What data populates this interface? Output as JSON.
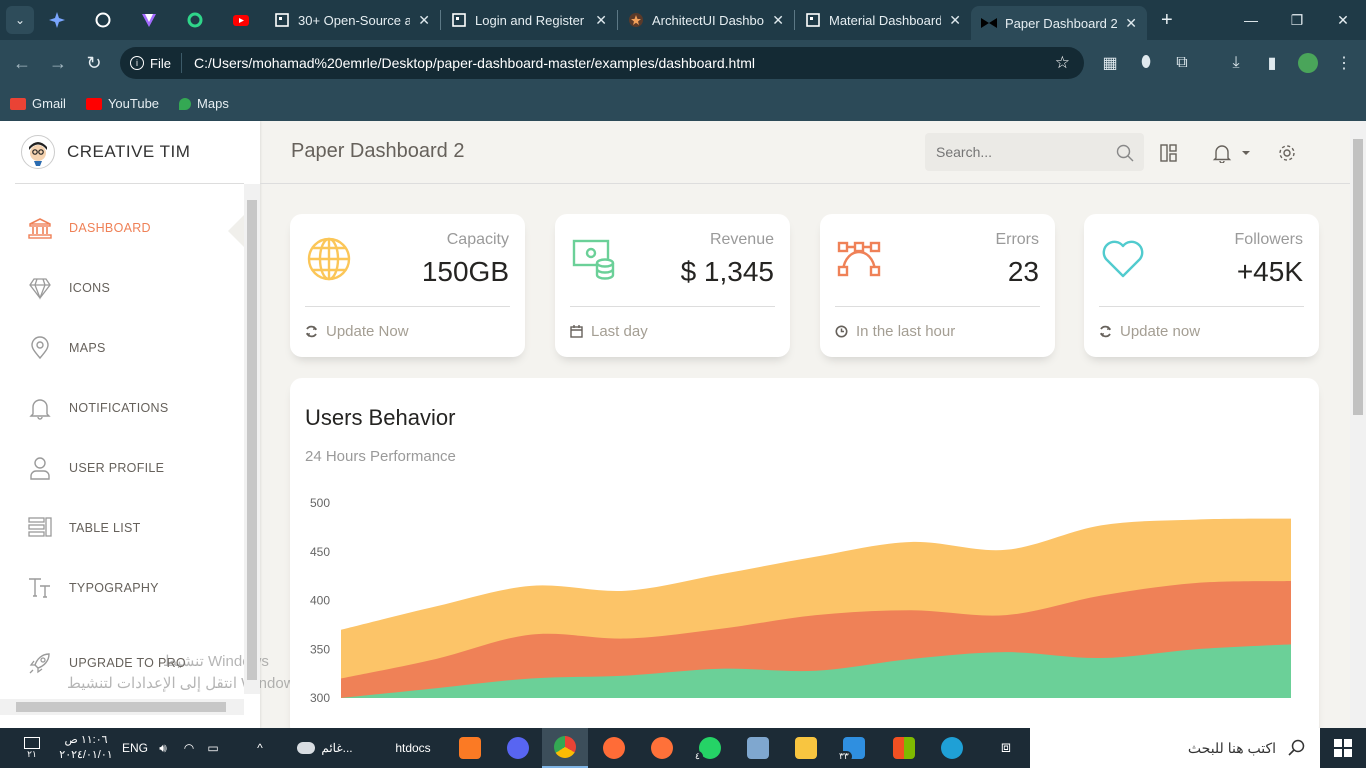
{
  "browser": {
    "tabs": [
      {
        "title": "30+ Open-Source a",
        "icon": "grid-page-icon"
      },
      {
        "title": "Login and Register",
        "icon": "grid-page-icon"
      },
      {
        "title": "ArchitectUI Dashbo",
        "icon": "star-badge-icon"
      },
      {
        "title": "Material Dashboard",
        "icon": "grid-page-icon"
      },
      {
        "title": "Paper Dashboard 2",
        "icon": "bowtie-icon"
      }
    ],
    "url_chip": "File",
    "url": "C:/Users/mohamad%20emrle/Desktop/paper-dashboard-master/examples/dashboard.html",
    "bookmarks": [
      {
        "label": "Gmail",
        "color": "#ea4335"
      },
      {
        "label": "YouTube",
        "color": "#ff0000"
      },
      {
        "label": "Maps",
        "color": "#34a853"
      }
    ]
  },
  "sidebar": {
    "brand": "CREATIVE TIM",
    "items": [
      {
        "label": "DASHBOARD",
        "icon": "bank-icon",
        "active": true
      },
      {
        "label": "ICONS",
        "icon": "diamond-icon",
        "active": false
      },
      {
        "label": "MAPS",
        "icon": "map-pin-icon",
        "active": false
      },
      {
        "label": "NOTIFICATIONS",
        "icon": "bell-icon",
        "active": false
      },
      {
        "label": "USER PROFILE",
        "icon": "user-icon",
        "active": false
      },
      {
        "label": "TABLE LIST",
        "icon": "list-icon",
        "active": false
      },
      {
        "label": "TYPOGRAPHY",
        "icon": "text-icon",
        "active": false
      },
      {
        "label": "UPGRADE TO PRO",
        "icon": "rocket-icon",
        "active": false
      }
    ]
  },
  "watermark": {
    "line1": "تنشيط Windows",
    "line2": "انتقل إلى الإعدادات لتنشيط Windows."
  },
  "header": {
    "title": "Paper Dashboard 2",
    "search_placeholder": "Search..."
  },
  "stats": [
    {
      "category": "Capacity",
      "value": "150GB",
      "footer": "Update Now",
      "icon": "globe-icon",
      "footer_icon": "refresh-icon",
      "color": "#fbc658"
    },
    {
      "category": "Revenue",
      "value": "$ 1,345",
      "footer": "Last day",
      "icon": "money-coins-icon",
      "footer_icon": "calendar-icon",
      "color": "#6bd098"
    },
    {
      "category": "Errors",
      "value": "23",
      "footer": "In the last hour",
      "icon": "vector-icon",
      "footer_icon": "clock-icon",
      "color": "#ef8157"
    },
    {
      "category": "Followers",
      "value": "+45K",
      "footer": "Update now",
      "icon": "heart-icon",
      "footer_icon": "refresh-icon",
      "color": "#51cbce"
    }
  ],
  "chart_data": {
    "type": "area",
    "title": "Users Behavior",
    "subtitle": "24 Hours Performance",
    "ylim": [
      300,
      500
    ],
    "yticks": [
      500,
      450,
      400,
      350,
      300
    ],
    "xticks_visible": false,
    "grid": false,
    "points": 11,
    "series": [
      {
        "color": "#fcc468",
        "values": [
          370,
          394,
          415,
          410,
          427,
          445,
          460,
          452,
          477,
          483,
          484
        ]
      },
      {
        "color": "#ef8157",
        "values": [
          320,
          340,
          365,
          361,
          371,
          385,
          390,
          385,
          405,
          418,
          420
        ]
      },
      {
        "color": "#6bd098",
        "values": [
          300,
          310,
          320,
          323,
          330,
          328,
          340,
          347,
          341,
          350,
          355
        ]
      }
    ]
  },
  "taskbar": {
    "time": "١١:٠٦ ص",
    "date": "٢٠٢٤/٠١/٠١",
    "lang": "ENG",
    "weather": "غائم...",
    "folder_label": "htdocs",
    "search_text": "اكتب هنا للبحث",
    "notification_count": "٢١",
    "mail_count": "٣٣",
    "whatsapp_count": "٤"
  }
}
